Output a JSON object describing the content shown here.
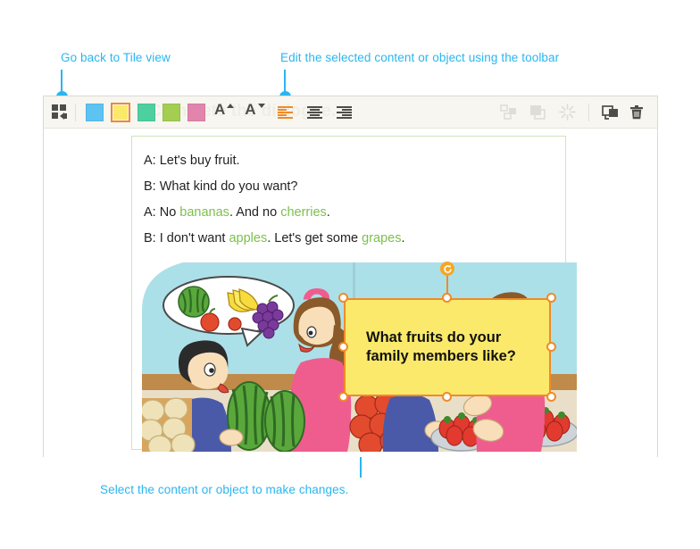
{
  "annotations": {
    "top_left": "Go back to Tile view",
    "top_right": "Edit the selected content or object using the toolbar",
    "bottom": "Select the content or object to make changes."
  },
  "toolbar": {
    "tile_view_label": "Tile view",
    "watermark": "Complete the dialogue.",
    "swatches": [
      {
        "name": "blue",
        "color": "#5cc3f2",
        "selected": false
      },
      {
        "name": "yellow",
        "color": "#fbe96b",
        "selected": true
      },
      {
        "name": "green",
        "color": "#4ecfa0",
        "selected": false
      },
      {
        "name": "olive",
        "color": "#a3ce52",
        "selected": false
      },
      {
        "name": "pink",
        "color": "#e285ac",
        "selected": false
      }
    ],
    "font_increase_label": "A",
    "font_decrease_label": "A",
    "align_left_label": "Align left",
    "align_center_label": "Align center",
    "align_right_label": "Align right",
    "group_label": "Group",
    "arrange_label": "Arrange",
    "effects_label": "Effects",
    "duplicate_label": "Duplicate",
    "delete_label": "Delete",
    "accent_color": "#f08a28"
  },
  "page": {
    "dialogue": [
      {
        "speaker": "A:",
        "parts": [
          {
            "t": " Let's buy fruit.",
            "hl": false
          }
        ]
      },
      {
        "speaker": "B:",
        "parts": [
          {
            "t": " What kind do you want?",
            "hl": false
          }
        ]
      },
      {
        "speaker": "A:",
        "parts": [
          {
            "t": " No ",
            "hl": false
          },
          {
            "t": "bananas",
            "hl": true
          },
          {
            "t": ". And no ",
            "hl": false
          },
          {
            "t": "cherries",
            "hl": true
          },
          {
            "t": ".",
            "hl": false
          }
        ]
      },
      {
        "speaker": "B:",
        "parts": [
          {
            "t": " I don't want ",
            "hl": false
          },
          {
            "t": "apples",
            "hl": true
          },
          {
            "t": ". Let's get some ",
            "hl": false
          },
          {
            "t": "grapes",
            "hl": true
          },
          {
            "t": ".",
            "hl": false
          }
        ]
      }
    ],
    "highlight_color": "#7dbf4c"
  },
  "selection": {
    "textbox_line1": "What fruits do your",
    "textbox_line2": "family members like?",
    "fill_color": "#fbe96b",
    "handle_color": "#f08a28"
  }
}
